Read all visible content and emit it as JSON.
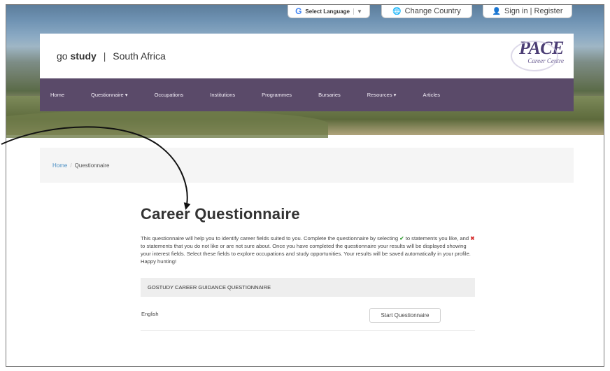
{
  "topbar": {
    "language_label": "Select Language",
    "language_caret": "▼",
    "language_icon": "G",
    "change_country": "Change Country",
    "globe_icon": "🌐",
    "user_icon": "👤",
    "sign_in": "Sign in | Register"
  },
  "header": {
    "brand_pre": "go",
    "brand_bold": "study",
    "brand_sep": "|",
    "brand_region": "South Africa",
    "logo_main": "PACE",
    "logo_sub": "Career Centre"
  },
  "nav": {
    "items": [
      "Home",
      "Questionnaire ▾",
      "Occupations",
      "Institutions",
      "Programmes",
      "Bursaries",
      "Resources ▾",
      "Articles"
    ]
  },
  "breadcrumb": {
    "home": "Home",
    "separator": "/",
    "current": "Questionnaire"
  },
  "main": {
    "title": "Career Questionnaire",
    "desc_1": "This questionnaire will help you to identify career fields suited to you. Complete the questionnaire by selecting",
    "desc_check": "✔",
    "desc_2": "to statements you like, and",
    "desc_cross": "✖",
    "desc_3": "to statements that you do not like or are not sure about. Once you have completed the questionnaire your results will be displayed showing your interest fields. Select these fields to explore occupations and study opportunities. Your results will be saved automatically in your profile. Happy hunting!",
    "section_header": "GOSTUDY CAREER GUIDANCE QUESTIONNAIRE",
    "language": "English",
    "start_button": "Start Questionnaire"
  },
  "colors": {
    "nav_bg": "#5a4a69",
    "link": "#4a8fc4",
    "check": "#3aa13a",
    "cross": "#d52b2b",
    "logo": "#4b3d74"
  }
}
